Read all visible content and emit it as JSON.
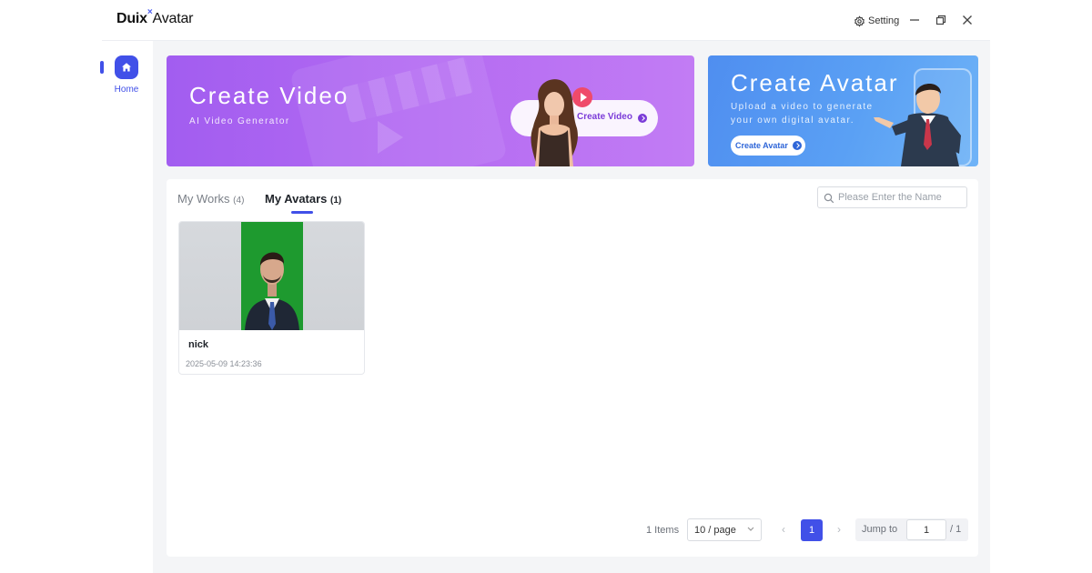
{
  "app": {
    "logo_part1": "Duix",
    "logo_mark": "×",
    "logo_part2": "Avatar",
    "setting_label": "Setting"
  },
  "sidebar": {
    "items": [
      {
        "label": "Home",
        "icon": "home-icon",
        "active": true
      }
    ]
  },
  "banners": {
    "video": {
      "title": "Create Video",
      "subtitle": "AI Video Generator",
      "button_label": "Create Video"
    },
    "avatar": {
      "title": "Create Avatar",
      "subtitle_line1": "Upload a video to generate",
      "subtitle_line2": "your own digital avatar.",
      "button_label": "Create Avatar"
    }
  },
  "tabs": [
    {
      "label": "My Works",
      "count": "(4)",
      "active": false
    },
    {
      "label": "My Avatars",
      "count": "(1)",
      "active": true
    }
  ],
  "search": {
    "placeholder": "Please Enter the Name",
    "value": ""
  },
  "avatars": [
    {
      "name": "nick",
      "date": "2025-05-09 14:23:36"
    }
  ],
  "pagination": {
    "total_text": "1 Items",
    "page_size": "10 / page",
    "current_page": "1",
    "prev_symbol": "‹",
    "next_symbol": "›",
    "jump_label": "Jump to",
    "jump_value": "1",
    "total_pages_text": "/ 1"
  },
  "colors": {
    "accent": "#4150e8",
    "video_banner": "#a25df0",
    "avatar_banner": "#4f8ef0",
    "card_photo_bg": "#1e9a2f"
  }
}
